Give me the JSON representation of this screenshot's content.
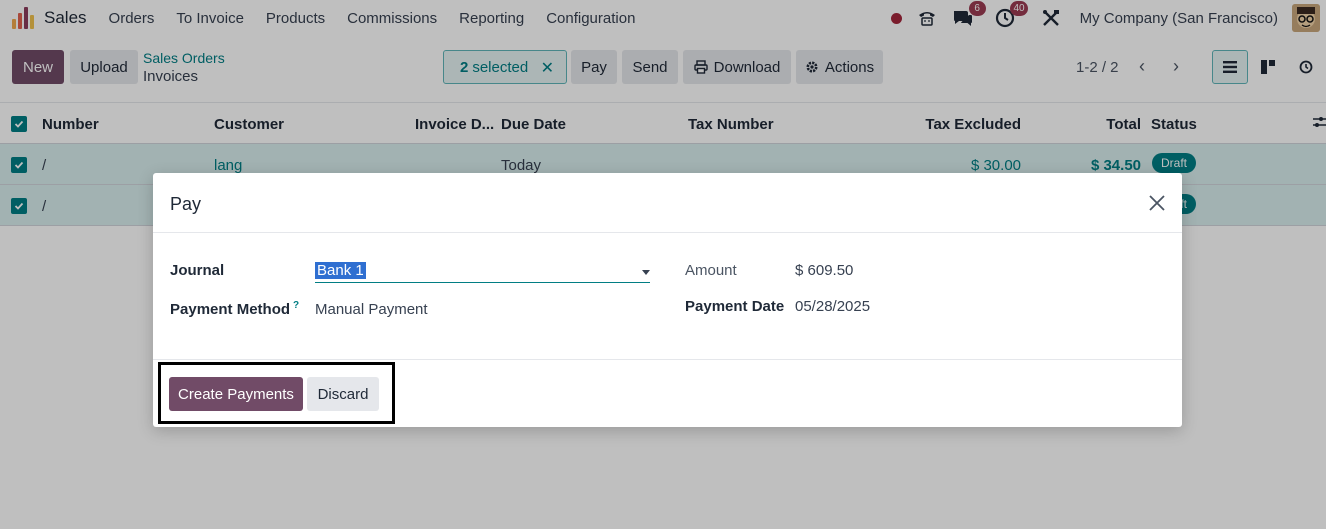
{
  "navbar": {
    "app_name": "Sales",
    "menu": [
      "Orders",
      "To Invoice",
      "Products",
      "Commissions",
      "Reporting",
      "Configuration"
    ],
    "chat_badge": "6",
    "activity_badge": "40",
    "company": "My Company (San Francisco)",
    "icons": [
      "app-grid-icon",
      "phone-icon",
      "chat-icon",
      "clock-icon",
      "tools-icon"
    ]
  },
  "control": {
    "new_label": "New",
    "upload_label": "Upload",
    "breadcrumb_parent": "Sales Orders",
    "breadcrumb_current": "Invoices",
    "selected_count": "2",
    "selected_text": "selected",
    "pay_label": "Pay",
    "send_label": "Send",
    "download_label": "Download",
    "actions_label": "Actions",
    "pager": "1-2 / 2"
  },
  "list": {
    "columns": [
      "Number",
      "Customer",
      "Invoice D...",
      "Due Date",
      "Tax Number",
      "Tax Excluded",
      "Total",
      "Status"
    ],
    "rows": [
      {
        "number": "/",
        "customer": "lang",
        "invoice_date": "",
        "due_date": "Today",
        "tax_number": "",
        "tax_excluded": "$ 30.00",
        "total": "$ 34.50",
        "status": "Draft"
      },
      {
        "number": "/",
        "customer": "",
        "invoice_date": "",
        "due_date": "",
        "tax_number": "",
        "tax_excluded": "",
        "total": "",
        "status": "Draft"
      }
    ]
  },
  "modal": {
    "title": "Pay",
    "journal_label": "Journal",
    "journal_value": "Bank 1",
    "payment_method_label": "Payment Method",
    "payment_method_help": "?",
    "payment_method_value": "Manual Payment",
    "amount_label": "Amount",
    "amount_value": "$ 609.50",
    "payment_date_label": "Payment Date",
    "payment_date_value": "05/28/2025",
    "create_label": "Create Payments",
    "discard_label": "Discard"
  },
  "colors": {
    "brand": "#714b67",
    "accent": "#017e84",
    "badge": "#9b3b52",
    "selection_row": "#d8eeee"
  }
}
